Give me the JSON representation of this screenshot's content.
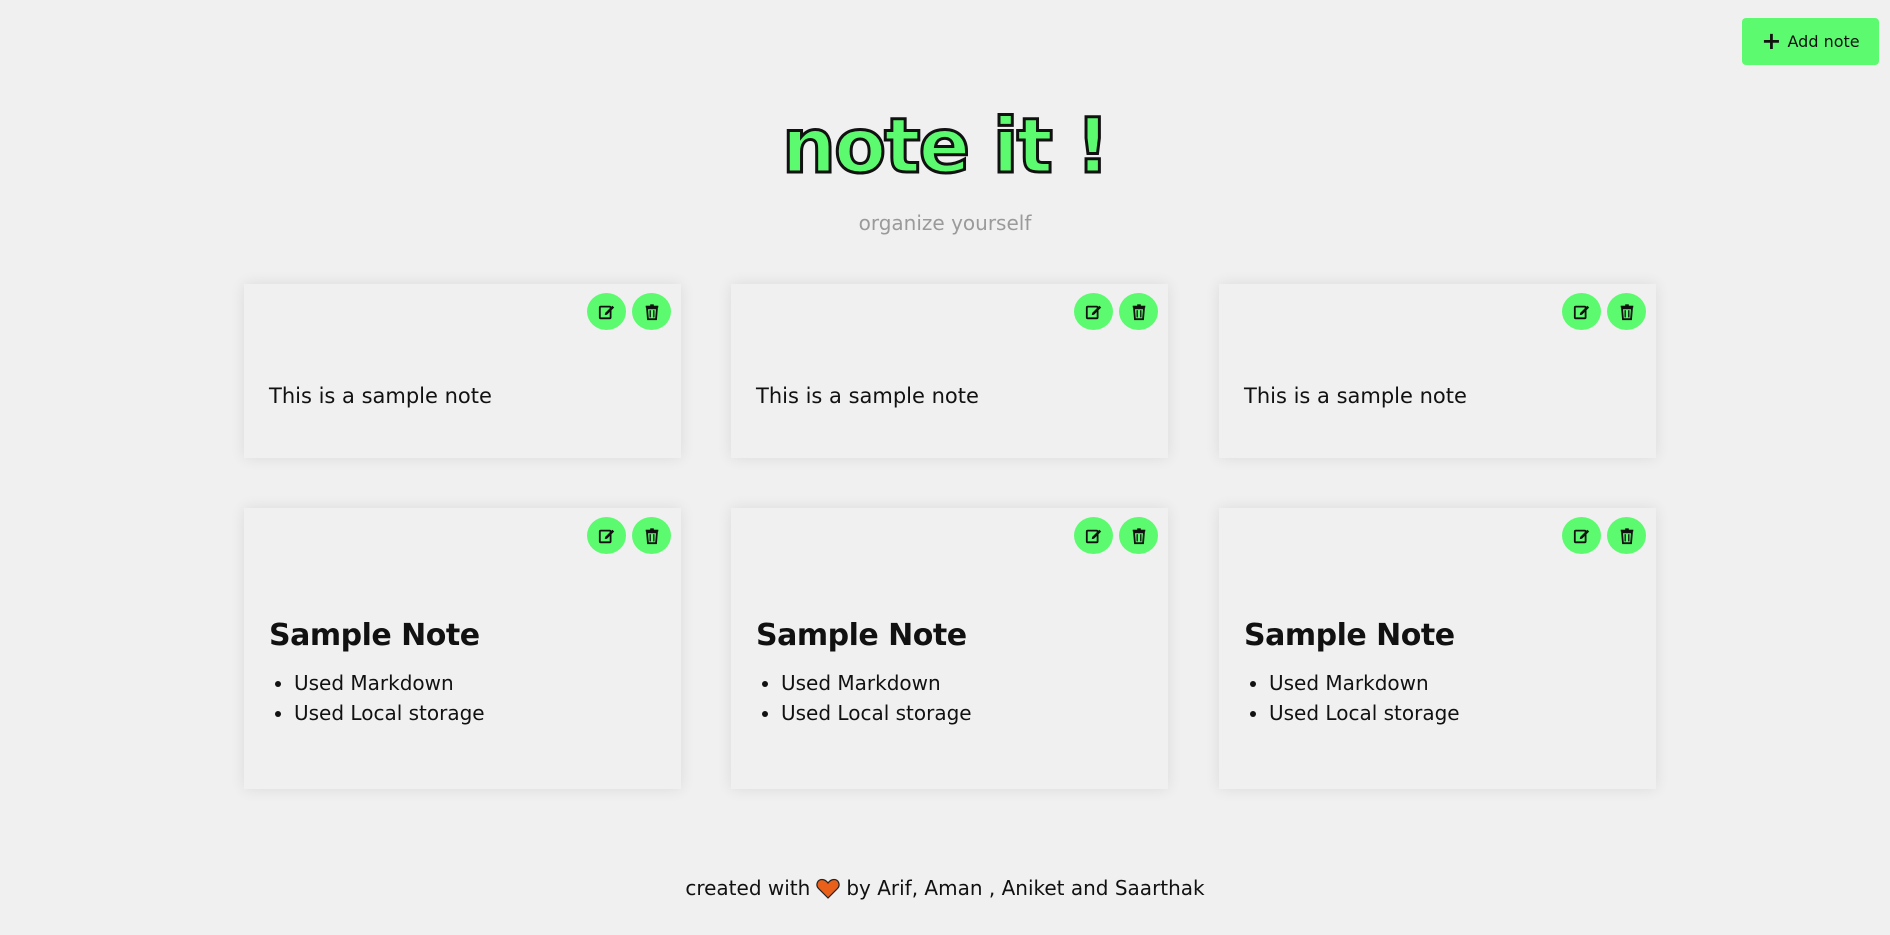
{
  "header": {
    "add_note_label": "Add note",
    "title": "note it !",
    "subtitle": "organize yourself"
  },
  "notes": [
    {
      "type": "text",
      "text": "This is a sample note"
    },
    {
      "type": "text",
      "text": "This is a sample note"
    },
    {
      "type": "text",
      "text": "This is a sample note"
    },
    {
      "type": "markdown",
      "heading": "Sample Note",
      "items": [
        "Used Markdown",
        "Used Local storage"
      ]
    },
    {
      "type": "markdown",
      "heading": "Sample Note",
      "items": [
        "Used Markdown",
        "Used Local storage"
      ]
    },
    {
      "type": "markdown",
      "heading": "Sample Note",
      "items": [
        "Used Markdown",
        "Used Local storage"
      ]
    }
  ],
  "icons": {
    "add": "plus-icon",
    "edit": "edit-icon",
    "delete": "trash-icon",
    "heart": "heart-icon"
  },
  "colors": {
    "accent": "#5cfb6f",
    "background": "#f0f0f0",
    "heart": "#e8601a"
  },
  "footer": {
    "prefix": "created with",
    "suffix": "by Arif, Aman , Aniket and Saarthak"
  }
}
